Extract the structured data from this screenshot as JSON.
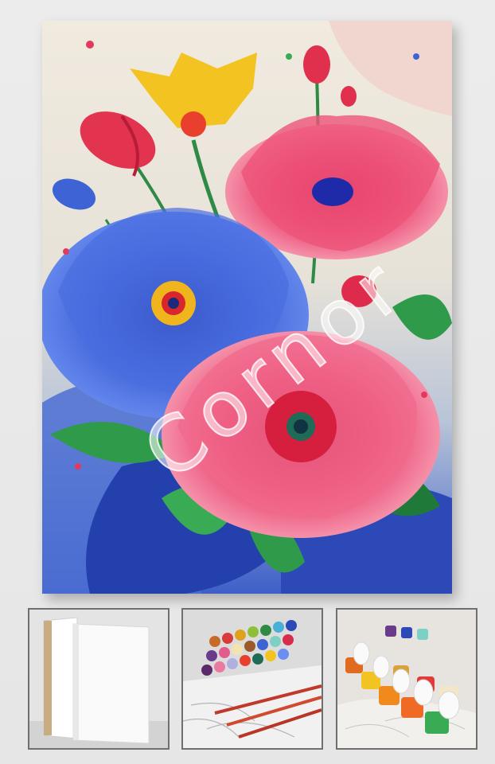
{
  "watermark": {
    "text": "Cornor"
  },
  "colors": {
    "background": "#e9e9e9",
    "canvas_base": "#efe8db",
    "blue_flower": "#3f62d8",
    "pink_flower": "#ea3f6c",
    "yellow_flower": "#f3c421",
    "leaf_green": "#2f9a4a",
    "thumbnail_border": "#6f6f6f"
  },
  "thumbnails": [
    {
      "subject": "blank-canvas-frames"
    },
    {
      "subject": "paint-pots-and-brushes"
    },
    {
      "subject": "open-paint-pots-closeup"
    }
  ]
}
